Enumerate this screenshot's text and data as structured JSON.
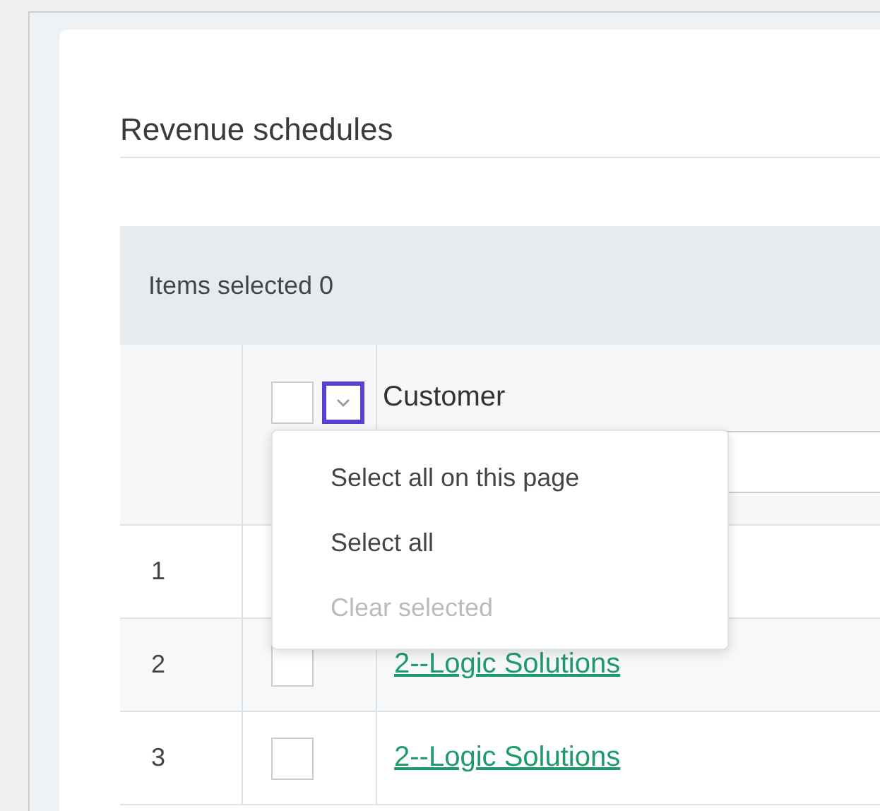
{
  "title": "Revenue schedules",
  "selection_bar": {
    "label": "Items selected 0"
  },
  "header": {
    "select_checked": false,
    "menu_expanded": true,
    "column": "Customer"
  },
  "menu": [
    {
      "label": "Select all on this page",
      "disabled": false
    },
    {
      "label": "Select all",
      "disabled": false
    },
    {
      "label": "Clear selected",
      "disabled": true
    }
  ],
  "rows": [
    {
      "index": "1"
    },
    {
      "index": "2",
      "checked": false,
      "customer": "2--Logic Solutions"
    },
    {
      "index": "3",
      "checked": false,
      "customer": "2--Logic Solutions"
    }
  ]
}
